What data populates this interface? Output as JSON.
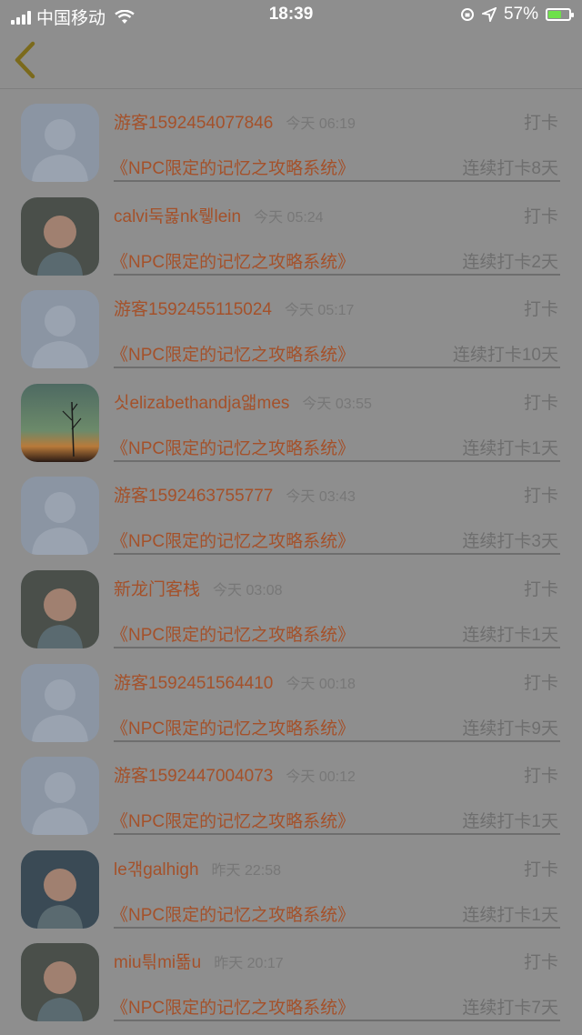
{
  "status": {
    "carrier": "中国移动",
    "time": "18:39",
    "battery": "57%",
    "battery_level": 0.57
  },
  "items": [
    {
      "name": "游客1592454077846",
      "time": "今天 06:19",
      "action": "打卡",
      "book": "《NPC限定的记忆之攻略系统》",
      "streak": "连续打卡8天",
      "avatar": "default-avatar"
    },
    {
      "name": "calvi둑몷nk뤻lein",
      "time": "今天 05:24",
      "action": "打卡",
      "book": "《NPC限定的记忆之攻略系统》",
      "streak": "连续打卡2天",
      "avatar": "photo-avatar"
    },
    {
      "name": "游客1592455115024",
      "time": "今天 05:17",
      "action": "打卡",
      "book": "《NPC限定的记忆之攻略系统》",
      "streak": "连续打卡10天",
      "avatar": "default-avatar"
    },
    {
      "name": "싯elizabethandja앫mes",
      "time": "今天 03:55",
      "action": "打卡",
      "book": "《NPC限定的记忆之攻略系统》",
      "streak": "连续打卡1天",
      "avatar": "sunset-avatar"
    },
    {
      "name": "游客1592463755777",
      "time": "今天 03:43",
      "action": "打卡",
      "book": "《NPC限定的记忆之攻略系统》",
      "streak": "连续打卡3天",
      "avatar": "default-avatar"
    },
    {
      "name": "新龙门客栈",
      "time": "今天 03:08",
      "action": "打卡",
      "book": "《NPC限定的记忆之攻略系统》",
      "streak": "连续打卡1天",
      "avatar": "photo-avatar"
    },
    {
      "name": "游客1592451564410",
      "time": "今天 00:18",
      "action": "打卡",
      "book": "《NPC限定的记忆之攻略系统》",
      "streak": "连续打卡9天",
      "avatar": "default-avatar"
    },
    {
      "name": "游客1592447004073",
      "time": "今天 00:12",
      "action": "打卡",
      "book": "《NPC限定的记忆之攻略系统》",
      "streak": "连续打卡1天",
      "avatar": "default-avatar"
    },
    {
      "name": "le갞galhigh",
      "time": "昨天 22:58",
      "action": "打卡",
      "book": "《NPC限定的记忆之攻略系统》",
      "streak": "连续打卡1天",
      "avatar": "photo-avatar"
    },
    {
      "name": "miu틖mi뚊u",
      "time": "昨天 20:17",
      "action": "打卡",
      "book": "《NPC限定的记忆之攻略系统》",
      "streak": "连续打卡7天",
      "avatar": "photo-avatar"
    }
  ],
  "colors": {
    "accent": "#a4512a",
    "back_arrow": "#7b6a1c",
    "overlay_bg": "#8e8e8e"
  }
}
